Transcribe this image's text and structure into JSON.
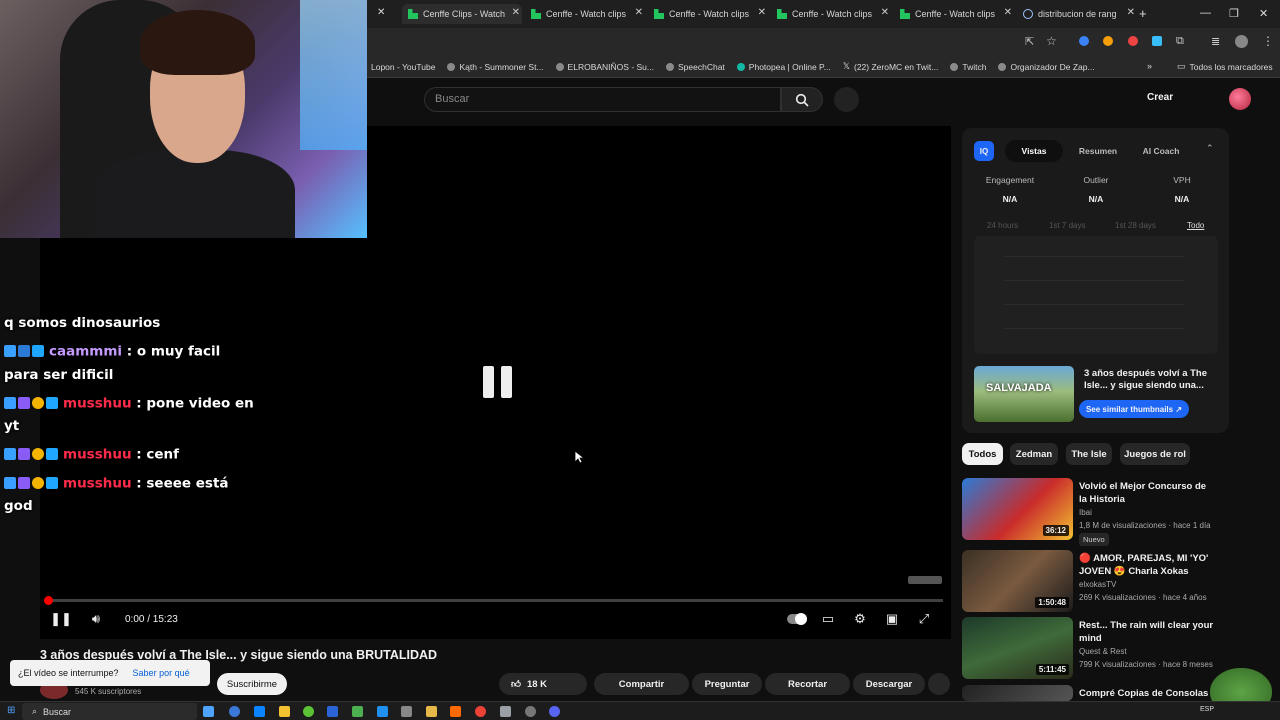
{
  "browser": {
    "tabs": [
      {
        "label": "Cenffe Clips - Watch"
      },
      {
        "label": "Cenffe - Watch clips"
      },
      {
        "label": "Cenffe - Watch clips"
      },
      {
        "label": "Cenffe - Watch clips"
      },
      {
        "label": "Cenffe - Watch clips"
      },
      {
        "label": "distribucion de rang"
      }
    ],
    "bookmarks": [
      {
        "label": "Lopon - YouTube"
      },
      {
        "label": "Kąth - Summoner St..."
      },
      {
        "label": "ELROBANIÑOS - Su..."
      },
      {
        "label": "SpeechChat"
      },
      {
        "label": "Photopea | Online P..."
      },
      {
        "label": "(22) ZeroMC en Twit..."
      },
      {
        "label": "Twitch"
      },
      {
        "label": "Organizador De Zap..."
      }
    ],
    "all_bookmarks": "Todos los marcadores"
  },
  "youtube": {
    "search_placeholder": "Buscar",
    "create_label": "Crear"
  },
  "chat": [
    {
      "user": "",
      "text": "q somos dinosaurios"
    },
    {
      "user": "caammmi",
      "text": ": o muy facil para ser dificil"
    },
    {
      "user": "musshuu",
      "text": ": pone video en yt"
    },
    {
      "user": "musshuu",
      "text": ": cenf"
    },
    {
      "user": "musshuu",
      "text": ": seeee está god"
    }
  ],
  "player": {
    "timecode": "0:00 / 15:23",
    "progress_fraction": 0.0
  },
  "video": {
    "title": "3 años después volví a The Isle... y sigue siendo una BRUTALIDAD",
    "subscribers": "545 K suscriptores",
    "subscribe_label": "Suscribirme",
    "interrupt_text": "¿El vídeo se interrumpe?",
    "interrupt_link": "Saber por qué",
    "likes": "18 K",
    "actions": [
      "Compartir",
      "Preguntar",
      "Recortar",
      "Descargar"
    ]
  },
  "iq": {
    "logo": "IQ",
    "tabs": [
      "Vistas",
      "Resumen",
      "AI Coach"
    ],
    "metrics": [
      {
        "label": "Engagement",
        "value": "N/A"
      },
      {
        "label": "Outlier",
        "value": "N/A"
      },
      {
        "label": "VPH",
        "value": "N/A"
      }
    ],
    "ranges": [
      "24 hours",
      "1st 7 days",
      "1st 28 days",
      "Todo"
    ],
    "thumb_text": "SALVAJADA",
    "thumb_title": "3 años después volví a The Isle... y sigue siendo una...",
    "similar_label": "See similar thumbnails ↗"
  },
  "chips": [
    "Todos",
    "Zedman",
    "The Isle",
    "Juegos de rol"
  ],
  "recommendations": [
    {
      "title": "Volvió el Mejor Concurso de la Historia",
      "channel": "Ibai",
      "meta": "1,8 M de visualizaciones · hace 1 día",
      "badge": "Nuevo",
      "duration": "36:12"
    },
    {
      "title": "🔴 AMOR, PAREJAS, MI 'YO' JOVEN 😍 Charla Xokas",
      "channel": "elxokasTV",
      "meta": "269 K visualizaciones · hace 4 años",
      "badge": "",
      "duration": "1:50:48"
    },
    {
      "title": "Rest... The rain will clear your mind",
      "channel": "Quest & Rest",
      "meta": "799 K visualizaciones · hace 8 meses",
      "badge": "",
      "duration": "5:11:45"
    },
    {
      "title": "Compré Copias de Consolas",
      "channel": "",
      "meta": "",
      "badge": "",
      "duration": ""
    }
  ],
  "taskbar": {
    "search": "Buscar",
    "lang": "ESP"
  },
  "colors": {
    "accent": "#1e66f5",
    "progress": "#ff0000",
    "chat_user_purple": "#c49aff",
    "chat_user_red": "#ff2b4b"
  }
}
